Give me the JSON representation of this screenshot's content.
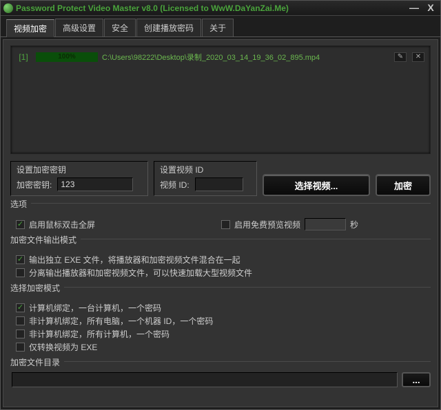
{
  "title": "Password Protect Video Master v8.0 (Licensed to WwW.DaYanZai.Me)",
  "tabs": [
    "视频加密",
    "高级设置",
    "安全",
    "创建播放密码",
    "关于"
  ],
  "active_tab": 0,
  "file": {
    "index": "[1]",
    "progress_pct": "100%",
    "path": "C:\\Users\\98222\\Desktop\\录制_2020_03_14_19_36_02_895.mp4",
    "edit_label": "✎",
    "close_label": "✕"
  },
  "key_section": {
    "title": "设置加密密钥",
    "label": "加密密钥:",
    "value": "123"
  },
  "video_id_section": {
    "title": "设置视频 ID",
    "label": "视频 ID:",
    "value": ""
  },
  "buttons": {
    "select_video": "选择视频...",
    "encrypt": "加密"
  },
  "options_section": {
    "title": "选项",
    "dbl_click": {
      "checked": true,
      "label": "启用鼠标双击全屏"
    },
    "preview": {
      "checked": false,
      "label": "启用免费预览视频",
      "seconds_value": "",
      "seconds_suffix": "秒"
    }
  },
  "output_mode_section": {
    "title": "加密文件输出模式",
    "items": [
      {
        "checked": true,
        "label": "输出独立 EXE 文件，将播放器和加密视频文件混合在一起"
      },
      {
        "checked": false,
        "label": "分离输出播放器和加密视频文件，可以快速加载大型视频文件"
      }
    ]
  },
  "encrypt_mode_section": {
    "title": "选择加密模式",
    "items": [
      {
        "checked": true,
        "label": "计算机绑定，一台计算机，一个密码"
      },
      {
        "checked": false,
        "label": "非计算机绑定，所有电脑，一个机器 ID，一个密码"
      },
      {
        "checked": false,
        "label": "非计算机绑定，所有计算机，一个密码"
      },
      {
        "checked": false,
        "label": "仅转换视频为 EXE"
      }
    ]
  },
  "output_dir_section": {
    "title": "加密文件目录",
    "value": "",
    "browse_label": "..."
  },
  "window_buttons": {
    "min": "—",
    "close": "X"
  }
}
